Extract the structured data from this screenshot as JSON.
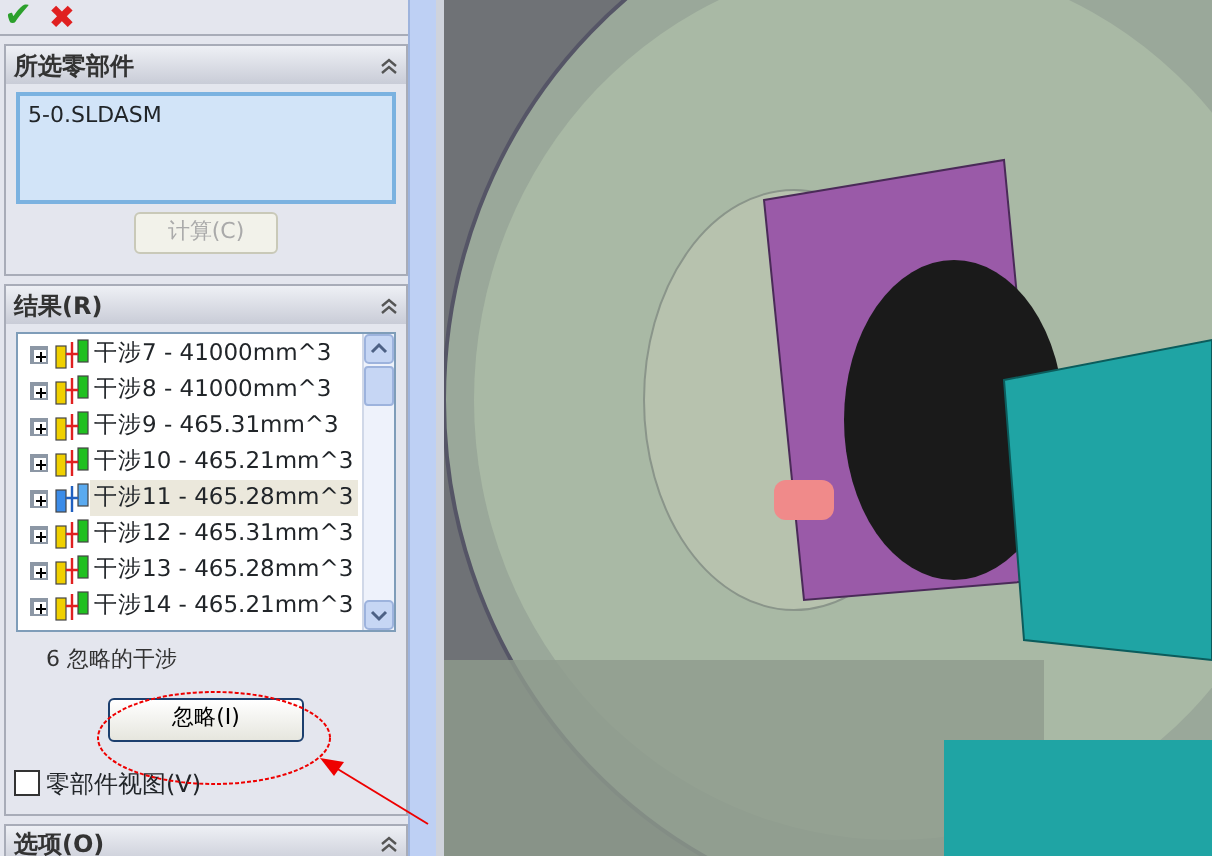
{
  "toolbar": {
    "ok": "✔",
    "cancel": "✖"
  },
  "selected_components": {
    "title": "所选零部件",
    "items": [
      "5-0.SLDASM"
    ],
    "button": {
      "label": "计算(C)",
      "disabled": true
    }
  },
  "results": {
    "title": "结果(R)",
    "items": [
      {
        "label": "干涉7 - 41000mm^3",
        "selected": false
      },
      {
        "label": "干涉8 - 41000mm^3",
        "selected": false
      },
      {
        "label": "干涉9 - 465.31mm^3",
        "selected": false
      },
      {
        "label": "干涉10 - 465.21mm^3",
        "selected": false
      },
      {
        "label": "干涉11 - 465.28mm^3",
        "selected": true
      },
      {
        "label": "干涉12 - 465.31mm^3",
        "selected": false
      },
      {
        "label": "干涉13 - 465.28mm^3",
        "selected": false
      },
      {
        "label": "干涉14 - 465.21mm^3",
        "selected": false
      }
    ],
    "ignored_count": "6 忽略的干涉",
    "button": {
      "label": "忽略(I)",
      "disabled": false
    },
    "component_view": {
      "label": "零部件视图(V)",
      "checked": false
    }
  },
  "options": {
    "title": "选项(O)"
  }
}
